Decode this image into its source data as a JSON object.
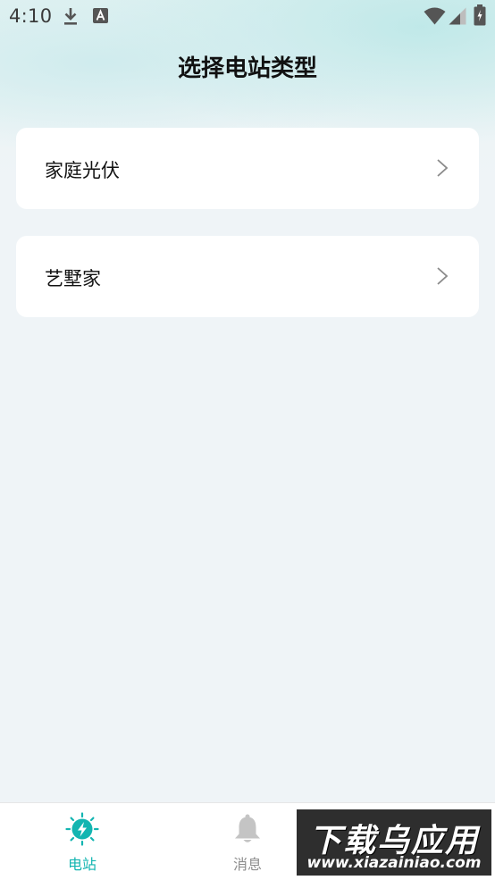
{
  "status_bar": {
    "time": "4:10",
    "icons": [
      "download-icon",
      "a-letter-icon",
      "wifi-icon",
      "signal-icon",
      "battery-icon"
    ]
  },
  "header": {
    "title": "选择电站类型"
  },
  "station_types": [
    {
      "label": "家庭光伏",
      "icon": "chevron-right-icon"
    },
    {
      "label": "艺墅家",
      "icon": "chevron-right-icon"
    }
  ],
  "bottom_nav": {
    "items": [
      {
        "label": "电站",
        "icon": "lightning-sun-icon",
        "active": true
      },
      {
        "label": "消息",
        "icon": "bell-icon",
        "active": false
      }
    ]
  },
  "watermark": {
    "title": "下载乌应用",
    "url": "www.xiazainiao.com"
  },
  "colors": {
    "accent": "#13b5b1",
    "inactive": "#8d8d8d",
    "background": "#eff4f7",
    "card": "#ffffff"
  }
}
